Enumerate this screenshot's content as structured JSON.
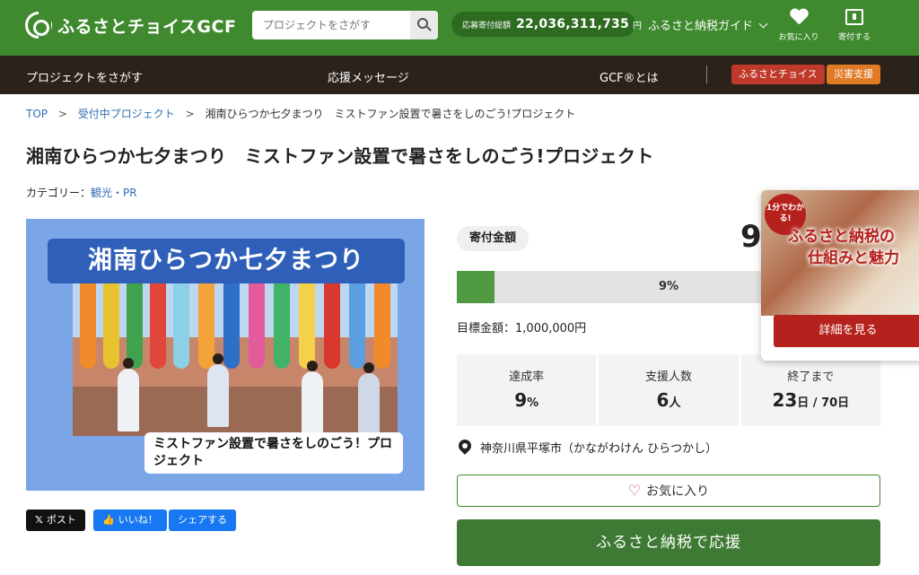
{
  "header": {
    "logo_text": "ふるさとチョイスGCF",
    "search_placeholder": "プロジェクトをさがす",
    "total_label": "応募寄付総額",
    "total_value": "22,036,311,735",
    "total_unit": "円",
    "guide_label": "ふるさと納税ガイド",
    "favorites_label": "お気に入り",
    "donate_label": "寄付する"
  },
  "nav": {
    "items": [
      "プロジェクトをさがす",
      "応援メッセージ",
      "GCF®とは"
    ],
    "tag_choice": "ふるさとチョイス",
    "tag_disaster": "災害支援",
    "colors": {
      "choice": "#c03a2b",
      "disaster": "#e07a25"
    }
  },
  "breadcrumb": {
    "items": [
      "TOP",
      "受付中プロジェクト",
      "湘南ひらつか七夕まつり　ミストファン設置で暑さをしのごう!プロジェクト"
    ]
  },
  "project": {
    "title": "湘南ひらつか七夕まつり　ミストファン設置で暑さをしのごう!プロジェクト",
    "category_label": "カテゴリー：",
    "category_value": "観光・PR",
    "hero_banner": "湘南ひらつか七夕まつり",
    "hero_caption": "ミストファン設置で暑さをしのごう！プロジェクト"
  },
  "share": {
    "post": "ポスト",
    "like": "いいね！",
    "share": "シェアする"
  },
  "funding": {
    "amount_label": "寄付金額",
    "amount_value": "9",
    "progress_percent": 9,
    "progress_label": "9%",
    "target_label": "目標金額：",
    "target_value": "1,000,000円",
    "stats": [
      {
        "label": "達成率",
        "value": "9",
        "unit": "%"
      },
      {
        "label": "支援人数",
        "value": "6",
        "unit": "人"
      },
      {
        "label": "終了まで",
        "value": "23",
        "unit": "日 / 70日"
      }
    ],
    "location": "神奈川県平塚市（かながわけん ひらつかし）",
    "favorite_button": "お気に入り",
    "donate_button": "ふるさと納税で応援"
  },
  "promo": {
    "badge": "1分でわかる!",
    "title_line1": "ふるさと納税の",
    "title_line2": "仕組みと魅力",
    "button": "詳細を見る"
  },
  "colors": {
    "brand_green": "#3f8a2e",
    "nav_dark": "#2a221b",
    "link_blue": "#2f6fb5",
    "promo_red": "#b5211c"
  }
}
